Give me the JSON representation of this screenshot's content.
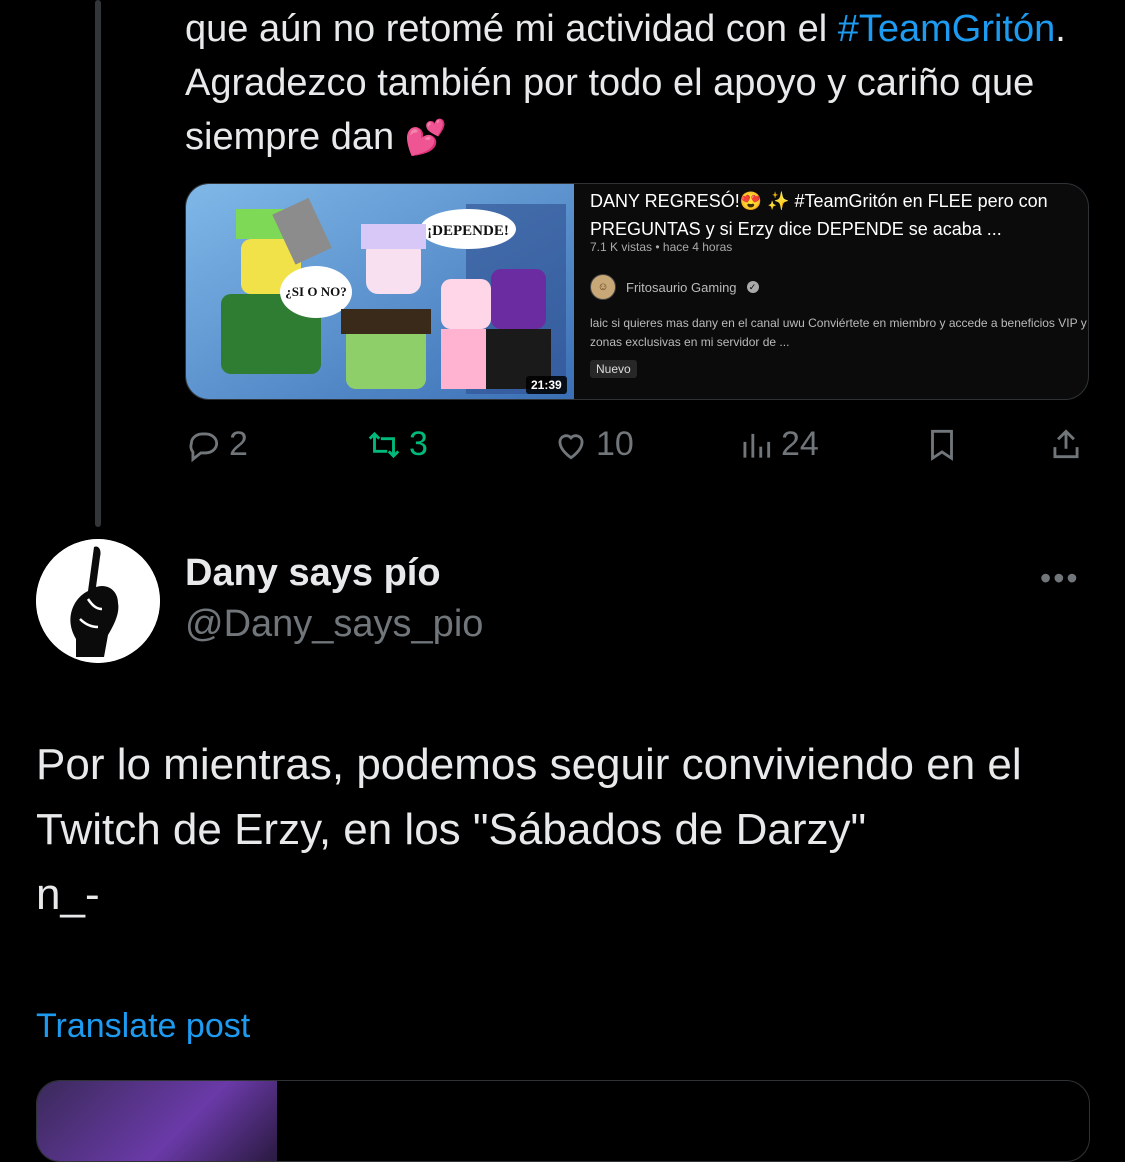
{
  "prev_post": {
    "text_before": "que aún no retomé mi actividad con el ",
    "hashtag": "#TeamGritón",
    "text_after": ". Agradezco también por todo el apoyo y cariño que siempre dan ",
    "emoji": "💕"
  },
  "youtube_card": {
    "title": "DANY REGRESÓ!😍 ✨ #TeamGritón en FLEE pero con PREGUNTAS y si Erzy dice DEPENDE se acaba ...",
    "meta": "7.1 K vistas • hace 4 horas",
    "channel": "Fritosaurio Gaming",
    "description": "laic si quieres mas dany en el canal uwu Conviértete en miembro y accede a beneficios VIP y zonas exclusivas en mi servidor de ...",
    "badge": "Nuevo",
    "duration": "21:39",
    "thumb_text_1": "¡DEPENDE!",
    "thumb_text_2": "¿SI O NO?"
  },
  "actions": {
    "replies": "2",
    "retweets": "3",
    "likes": "10",
    "views": "24"
  },
  "post": {
    "display_name": "Dany says pío",
    "handle": "@Dany_says_pio",
    "more": "•••",
    "text": "Por lo mientras, podemos seguir conviviendo en el Twitch de Erzy, en los \"Sábados de Darzy\"\nn_-",
    "translate": "Translate post"
  },
  "colors": {
    "background": "#000000",
    "text": "#e7e9ea",
    "secondary": "#71767b",
    "link": "#1d9bf0",
    "retweet": "#00ba7c"
  }
}
